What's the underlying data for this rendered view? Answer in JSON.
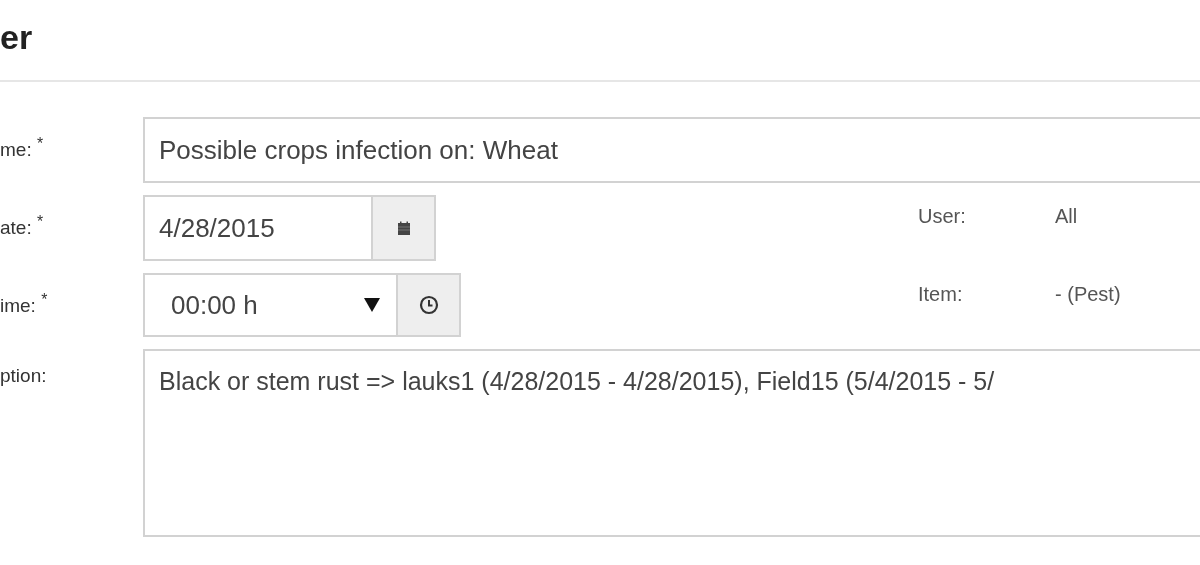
{
  "heading": "er",
  "fields": [
    {
      "label": "me: $^{*}$",
      "kind": "text",
      "value": "Possible crops infection on: Wheat"
    },
    {
      "label": "ate: $^{*}$",
      "kind": "date",
      "value": "4/28/2015"
    },
    {
      "label": "ime: $^{*}$",
      "kind": "time",
      "value": "00:00 h"
    },
    {
      "label": "ption:",
      "kind": "textarea",
      "value": "Black or stem rust => lauks1 (4/28/2015 - 4/28/2015), Field15 (5/4/2015 - 5/"
    }
  ],
  "info": [
    {
      "label": "User:",
      "value": "All"
    },
    {
      "label": "Item:",
      "value": "- (Pest)"
    }
  ]
}
